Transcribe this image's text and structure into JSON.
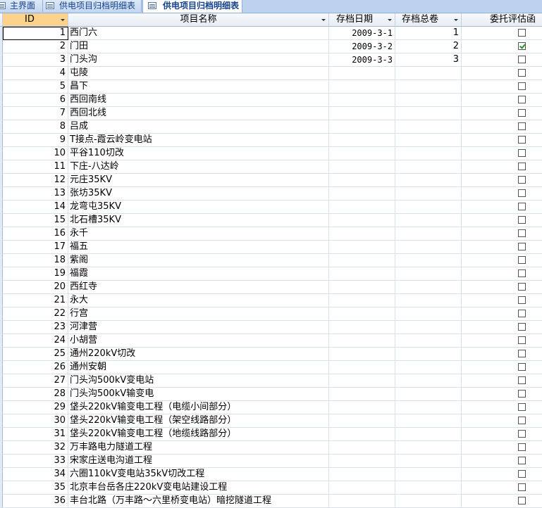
{
  "tabs": [
    {
      "label": "主界面",
      "icon": "form-icon",
      "active": false
    },
    {
      "label": "供电项目归档明细表",
      "icon": "form-icon",
      "active": false
    },
    {
      "label": "供电项目归档明细表",
      "icon": "table-icon",
      "active": true
    }
  ],
  "columns": [
    {
      "key": "id",
      "label": "ID"
    },
    {
      "key": "name",
      "label": "项目名称"
    },
    {
      "key": "date",
      "label": "存档日期"
    },
    {
      "key": "volumes",
      "label": "存档总卷"
    },
    {
      "key": "entrust",
      "label": "委托评估函"
    }
  ],
  "rows": [
    {
      "id": "1",
      "name": "西门六",
      "date": "2009-3-1",
      "volumes": "1",
      "entrust": false
    },
    {
      "id": "2",
      "name": "门田",
      "date": "2009-3-2",
      "volumes": "2",
      "entrust": true
    },
    {
      "id": "3",
      "name": "门头沟",
      "date": "2009-3-3",
      "volumes": "3",
      "entrust": false
    },
    {
      "id": "4",
      "name": "屯陵",
      "date": "",
      "volumes": "",
      "entrust": false
    },
    {
      "id": "5",
      "name": "昌下",
      "date": "",
      "volumes": "",
      "entrust": false
    },
    {
      "id": "6",
      "name": "西回南线",
      "date": "",
      "volumes": "",
      "entrust": false
    },
    {
      "id": "7",
      "name": "西回北线",
      "date": "",
      "volumes": "",
      "entrust": false
    },
    {
      "id": "8",
      "name": "吕成",
      "date": "",
      "volumes": "",
      "entrust": false
    },
    {
      "id": "9",
      "name": "T接点-霞云岭变电站",
      "date": "",
      "volumes": "",
      "entrust": false
    },
    {
      "id": "10",
      "name": "平谷110切改",
      "date": "",
      "volumes": "",
      "entrust": false
    },
    {
      "id": "11",
      "name": "下庄-八达岭",
      "date": "",
      "volumes": "",
      "entrust": false
    },
    {
      "id": "12",
      "name": "元庄35KV",
      "date": "",
      "volumes": "",
      "entrust": false
    },
    {
      "id": "13",
      "name": "张坊35KV",
      "date": "",
      "volumes": "",
      "entrust": false
    },
    {
      "id": "14",
      "name": "龙弯屯35KV",
      "date": "",
      "volumes": "",
      "entrust": false
    },
    {
      "id": "15",
      "name": "北石槽35KV",
      "date": "",
      "volumes": "",
      "entrust": false
    },
    {
      "id": "16",
      "name": "永千",
      "date": "",
      "volumes": "",
      "entrust": false
    },
    {
      "id": "17",
      "name": "福五",
      "date": "",
      "volumes": "",
      "entrust": false
    },
    {
      "id": "18",
      "name": "紫阁",
      "date": "",
      "volumes": "",
      "entrust": false
    },
    {
      "id": "19",
      "name": "福霞",
      "date": "",
      "volumes": "",
      "entrust": false
    },
    {
      "id": "20",
      "name": "西红寺",
      "date": "",
      "volumes": "",
      "entrust": false
    },
    {
      "id": "21",
      "name": "永大",
      "date": "",
      "volumes": "",
      "entrust": false
    },
    {
      "id": "22",
      "name": "行宫",
      "date": "",
      "volumes": "",
      "entrust": false
    },
    {
      "id": "23",
      "name": "河津营",
      "date": "",
      "volumes": "",
      "entrust": false
    },
    {
      "id": "24",
      "name": "小胡营",
      "date": "",
      "volumes": "",
      "entrust": false
    },
    {
      "id": "25",
      "name": "通州220kV切改",
      "date": "",
      "volumes": "",
      "entrust": false
    },
    {
      "id": "26",
      "name": "通州安朝",
      "date": "",
      "volumes": "",
      "entrust": false
    },
    {
      "id": "27",
      "name": "门头沟500kV变电站",
      "date": "",
      "volumes": "",
      "entrust": false
    },
    {
      "id": "28",
      "name": "门头沟500kV输变电",
      "date": "",
      "volumes": "",
      "entrust": false
    },
    {
      "id": "29",
      "name": "垡头220kV输变电工程（电缆小间部分）",
      "date": "",
      "volumes": "",
      "entrust": false
    },
    {
      "id": "30",
      "name": "垡头220kV输变电工程（架空线路部分）",
      "date": "",
      "volumes": "",
      "entrust": false
    },
    {
      "id": "31",
      "name": "垡头220kV输变电工程（地缆线路部分）",
      "date": "",
      "volumes": "",
      "entrust": false
    },
    {
      "id": "32",
      "name": "万丰路电力隧道工程",
      "date": "",
      "volumes": "",
      "entrust": false
    },
    {
      "id": "33",
      "name": "宋家庄送电沟道工程",
      "date": "",
      "volumes": "",
      "entrust": false
    },
    {
      "id": "34",
      "name": "六圈110kV变电站35kV切改工程",
      "date": "",
      "volumes": "",
      "entrust": false
    },
    {
      "id": "35",
      "name": "北京丰台岳各庄220kV变电站建设工程",
      "date": "",
      "volumes": "",
      "entrust": false
    },
    {
      "id": "36",
      "name": "丰台北路（万丰路～六里桥变电站）暗挖隧道工程",
      "date": "",
      "volumes": "",
      "entrust": false
    }
  ]
}
